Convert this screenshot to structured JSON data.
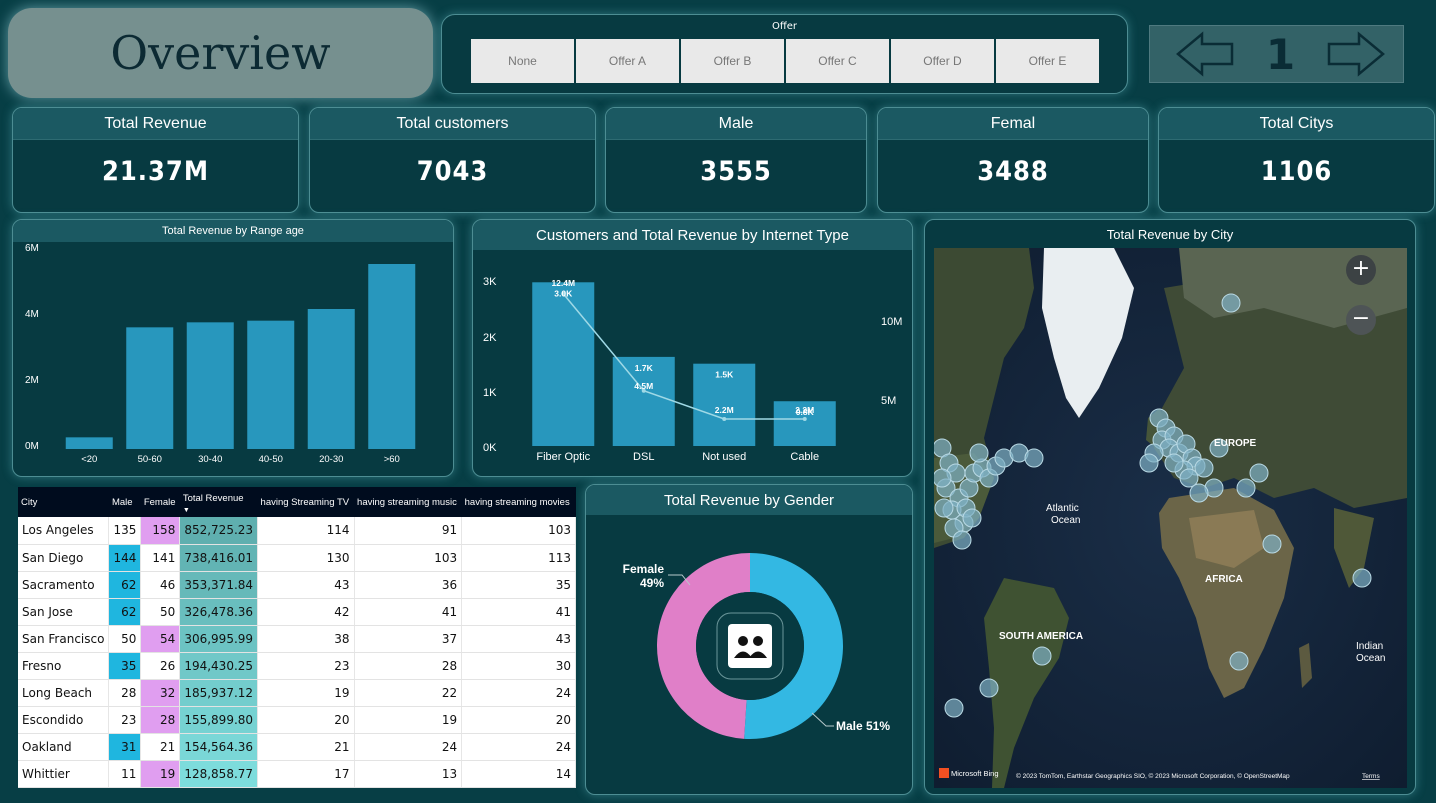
{
  "title": "Overview",
  "offer_slicer": {
    "title": "Offer",
    "options": [
      "None",
      "Offer A",
      "Offer B",
      "Offer C",
      "Offer D",
      "Offer E"
    ]
  },
  "pager": {
    "page": "1",
    "prev_icon": "arrow-left-icon",
    "next_icon": "arrow-right-icon"
  },
  "kpis": [
    {
      "label": "Total Revenue",
      "value": "21.37M"
    },
    {
      "label": "Total customers",
      "value": "7043"
    },
    {
      "label": "Male",
      "value": "3555"
    },
    {
      "label": "Femal",
      "value": "3488"
    },
    {
      "label": "Total Citys",
      "value": "1106"
    }
  ],
  "age_chart": {
    "title": "Total Revenue by Range age",
    "y_ticks": [
      "0M",
      "2M",
      "4M",
      "6M"
    ],
    "bar_color": "#2897bd"
  },
  "internet_chart": {
    "title": "Customers and  Total Revenue by Internet Type",
    "left_ticks": [
      "0K",
      "1K",
      "2K",
      "3K"
    ],
    "right_ticks": [
      "5M",
      "10M"
    ],
    "revenue_labels": [
      "12.4M",
      "4.5M",
      "2.2M",
      "2.2M"
    ],
    "customer_labels": [
      "3.0K",
      "1.7K",
      "1.5K",
      "0.8K"
    ]
  },
  "gender_chart": {
    "title": "Total Revenue by Gender",
    "female_label": "Female",
    "female_pct": "49%",
    "male_label": "Male 51%",
    "male_color": "#33b8e3",
    "female_color": "#e07fc8",
    "center_icon": "users-icon"
  },
  "table": {
    "headers": [
      "City",
      "Male",
      "Female",
      "Total Revenue",
      "having Streaming TV",
      "having streaming music",
      "having streaming movies"
    ],
    "rows": [
      [
        "Los Angeles",
        "135",
        "158",
        "852,725.23",
        "114",
        "91",
        "103"
      ],
      [
        "San Diego",
        "144",
        "141",
        "738,416.01",
        "130",
        "103",
        "113"
      ],
      [
        "Sacramento",
        "62",
        "46",
        "353,371.84",
        "43",
        "36",
        "35"
      ],
      [
        "San Jose",
        "62",
        "50",
        "326,478.36",
        "42",
        "41",
        "41"
      ],
      [
        "San Francisco",
        "50",
        "54",
        "306,995.99",
        "38",
        "37",
        "43"
      ],
      [
        "Fresno",
        "35",
        "26",
        "194,430.25",
        "23",
        "28",
        "30"
      ],
      [
        "Long Beach",
        "28",
        "32",
        "185,937.12",
        "19",
        "22",
        "24"
      ],
      [
        "Escondido",
        "23",
        "28",
        "155,899.80",
        "20",
        "19",
        "20"
      ],
      [
        "Oakland",
        "31",
        "21",
        "154,564.36",
        "21",
        "24",
        "24"
      ],
      [
        "Whittier",
        "11",
        "19",
        "128,858.77",
        "17",
        "13",
        "14"
      ]
    ],
    "male_highlight": [
      false,
      true,
      true,
      true,
      false,
      true,
      false,
      false,
      true,
      false
    ],
    "female_highlight": [
      true,
      false,
      false,
      false,
      true,
      false,
      true,
      true,
      false,
      true
    ]
  },
  "map": {
    "title": "Total Revenue by City",
    "zoom_in": "+",
    "zoom_out": "−",
    "labels": [
      "EUROPE",
      "Atlantic",
      "Ocean",
      "AFRICA",
      "SOUTH AMERICA",
      "Indian",
      "Ocean"
    ],
    "attribution": "© 2023 TomTom, Earthstar Geographics SIO, © 2023 Microsoft Corporation, © OpenStreetMap",
    "terms": "Terms",
    "brand": "Microsoft Bing"
  },
  "chart_data": [
    {
      "type": "bar",
      "title": "Total Revenue by Range age",
      "categories": [
        "<20",
        "50-60",
        "30-40",
        "40-50",
        "20-30",
        ">60"
      ],
      "values": [
        0.35,
        3.65,
        3.8,
        3.85,
        4.2,
        5.55
      ],
      "unit": "M",
      "ylim": [
        0,
        6
      ],
      "grid": false
    },
    {
      "type": "bar",
      "title": "Customers and  Total Revenue by Internet Type",
      "categories": [
        "Fiber Optic",
        "DSL",
        "Not used",
        "Cable"
      ],
      "series": [
        {
          "values": [
            3035,
            1652,
            1526,
            830
          ],
          "unit": "count",
          "render": "bar"
        },
        {
          "values": [
            12.4,
            4.5,
            2.2,
            2.2
          ],
          "unit": "M",
          "render": "line"
        }
      ],
      "ylim_left": [
        0,
        3300
      ],
      "ylim_right": [
        0,
        14.5
      ]
    },
    {
      "type": "pie",
      "title": "Total Revenue by Gender",
      "categories": [
        "Male",
        "Female"
      ],
      "values": [
        51,
        49
      ],
      "hole": true
    }
  ]
}
